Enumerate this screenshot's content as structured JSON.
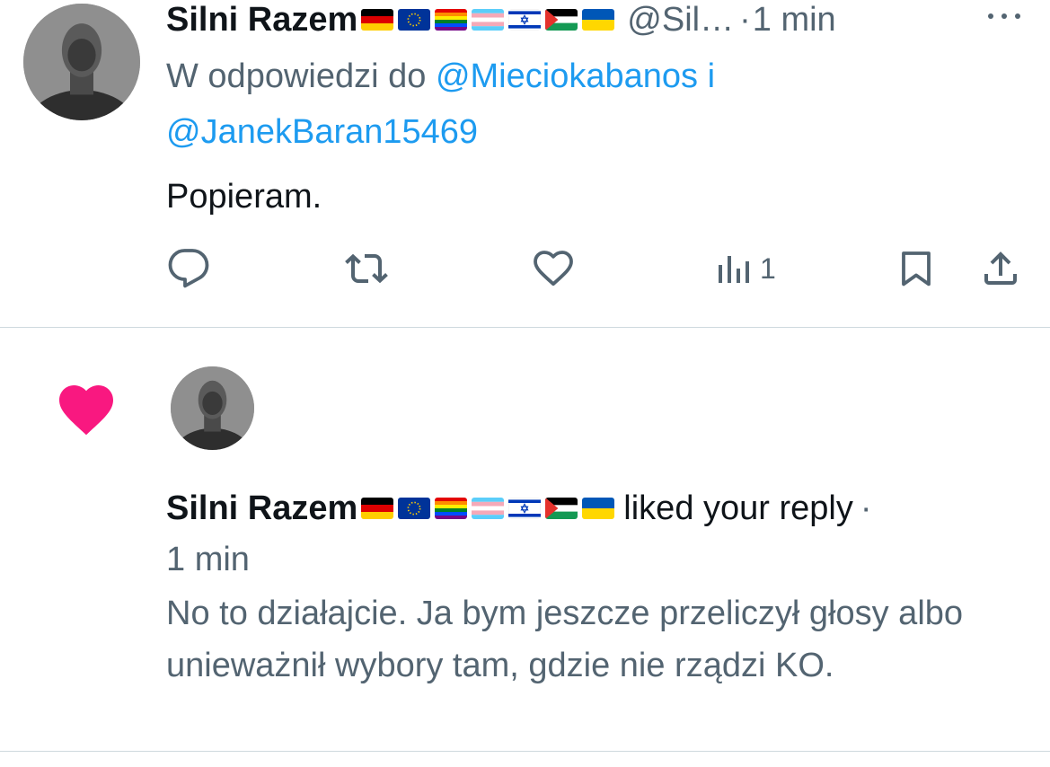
{
  "tweet": {
    "author_name": "Silni Razem",
    "author_flags": [
      "germany-flag",
      "eu-flag",
      "rainbow-flag",
      "transgender-flag",
      "israel-flag",
      "palestine-flag",
      "ukraine-flag"
    ],
    "handle": "@Sil…",
    "separator": "·",
    "time": "1 min",
    "reply_prefix": "W odpowiedzi do",
    "mention_1": "@Mieciokabanos",
    "reply_conj": "i",
    "mention_2": "@JanekBaran15469",
    "text": "Popieram.",
    "actions": {
      "reply_icon": "reply-icon",
      "retweet_icon": "retweet-icon",
      "like_icon": "heart-outline-icon",
      "views_icon": "views-chart-icon",
      "views_count": "1",
      "bookmark_icon": "bookmark-icon",
      "share_icon": "share-icon"
    },
    "more_icon": "more-dots-icon"
  },
  "notification": {
    "type_icon": "heart-filled-icon",
    "author_name": "Silni Razem",
    "action_text": "liked your reply",
    "separator": "·",
    "time": "1 min",
    "text": "No to działajcie. Ja bym jeszcze przeliczył głosy albo unieważnił wybory tam, gdzie nie rządzi KO."
  },
  "colors": {
    "text": "#0f1419",
    "secondary": "#536471",
    "link": "#1d9bf0",
    "like_pink": "#f91880",
    "divider": "#cfd9de"
  }
}
